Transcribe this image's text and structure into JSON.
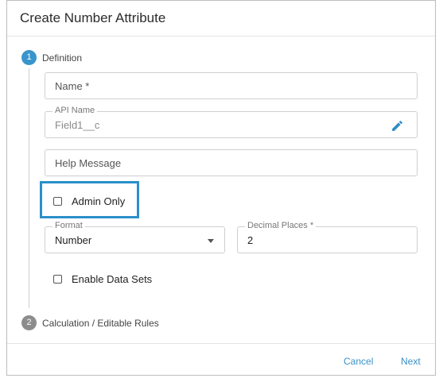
{
  "dialog": {
    "title": "Create Number Attribute"
  },
  "steps": [
    {
      "number": "1",
      "label": "Definition",
      "color": "#3a94cc"
    },
    {
      "number": "2",
      "label": "Calculation / Editable Rules",
      "color": "#8c8c8c"
    }
  ],
  "form": {
    "name_placeholder": "Name *",
    "api_name_label": "API Name",
    "api_name_value": "Field1__c",
    "help_placeholder": "Help Message",
    "admin_only_label": "Admin Only",
    "format_label": "Format",
    "format_value": "Number",
    "decimal_label": "Decimal Places *",
    "decimal_value": "2",
    "enable_datasets_label": "Enable Data Sets"
  },
  "footer": {
    "cancel_label": "Cancel",
    "next_label": "Next"
  },
  "colors": {
    "accent": "#3a8fc6",
    "highlight": "#2a90c9"
  }
}
